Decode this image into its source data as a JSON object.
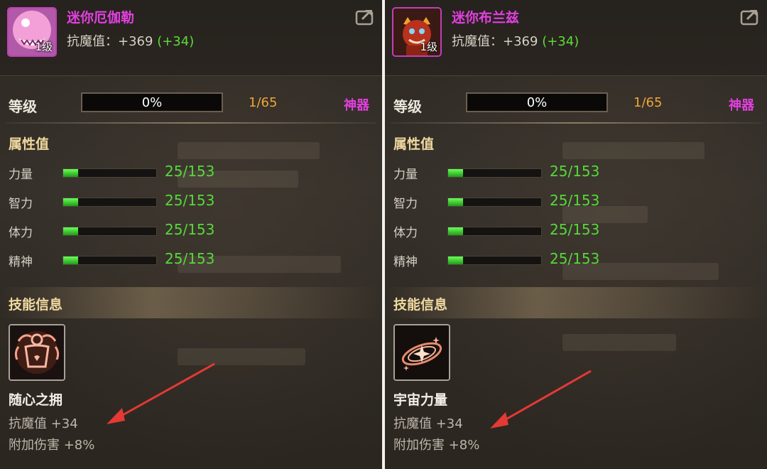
{
  "panels": [
    {
      "pet_name": "迷你厄伽勒",
      "level_badge": "1级",
      "resist_label": "抗魔值：",
      "resist_value": "+369",
      "resist_bonus": "(+34)",
      "level_label": "等级",
      "level_progress": 0,
      "level_progress_text": "0%",
      "level_count": "1/65",
      "artifact_label": "神器",
      "attributes_title": "属性值",
      "attributes": [
        {
          "name": "力量",
          "value": "25/153",
          "fraction": 0.163
        },
        {
          "name": "智力",
          "value": "25/153",
          "fraction": 0.163
        },
        {
          "name": "体力",
          "value": "25/153",
          "fraction": 0.163
        },
        {
          "name": "精神",
          "value": "25/153",
          "fraction": 0.163
        }
      ],
      "skill_title": "技能信息",
      "skill_icon": "embrace-figure-icon",
      "skill_name": "随心之拥",
      "skill_effects": [
        "抗魔值 +34",
        "附加伤害 +8%"
      ]
    },
    {
      "pet_name": "迷你布兰兹",
      "level_badge": "1级",
      "resist_label": "抗魔值：",
      "resist_value": "+369",
      "resist_bonus": "(+34)",
      "level_label": "等级",
      "level_progress": 0,
      "level_progress_text": "0%",
      "level_count": "1/65",
      "artifact_label": "神器",
      "attributes_title": "属性值",
      "attributes": [
        {
          "name": "力量",
          "value": "25/153",
          "fraction": 0.163
        },
        {
          "name": "智力",
          "value": "25/153",
          "fraction": 0.163
        },
        {
          "name": "体力",
          "value": "25/153",
          "fraction": 0.163
        },
        {
          "name": "精神",
          "value": "25/153",
          "fraction": 0.163
        }
      ],
      "skill_title": "技能信息",
      "skill_icon": "cosmic-swirl-icon",
      "skill_name": "宇宙力量",
      "skill_effects": [
        "抗魔值 +34",
        "附加伤害 +8%"
      ]
    }
  ],
  "colors": {
    "name": "#e33fe0",
    "bonus": "#5ddc3a",
    "stat_value": "#57d83a",
    "level_count": "#f0a43a",
    "section_title": "#f0d9a0",
    "arrow": "#e53935"
  }
}
